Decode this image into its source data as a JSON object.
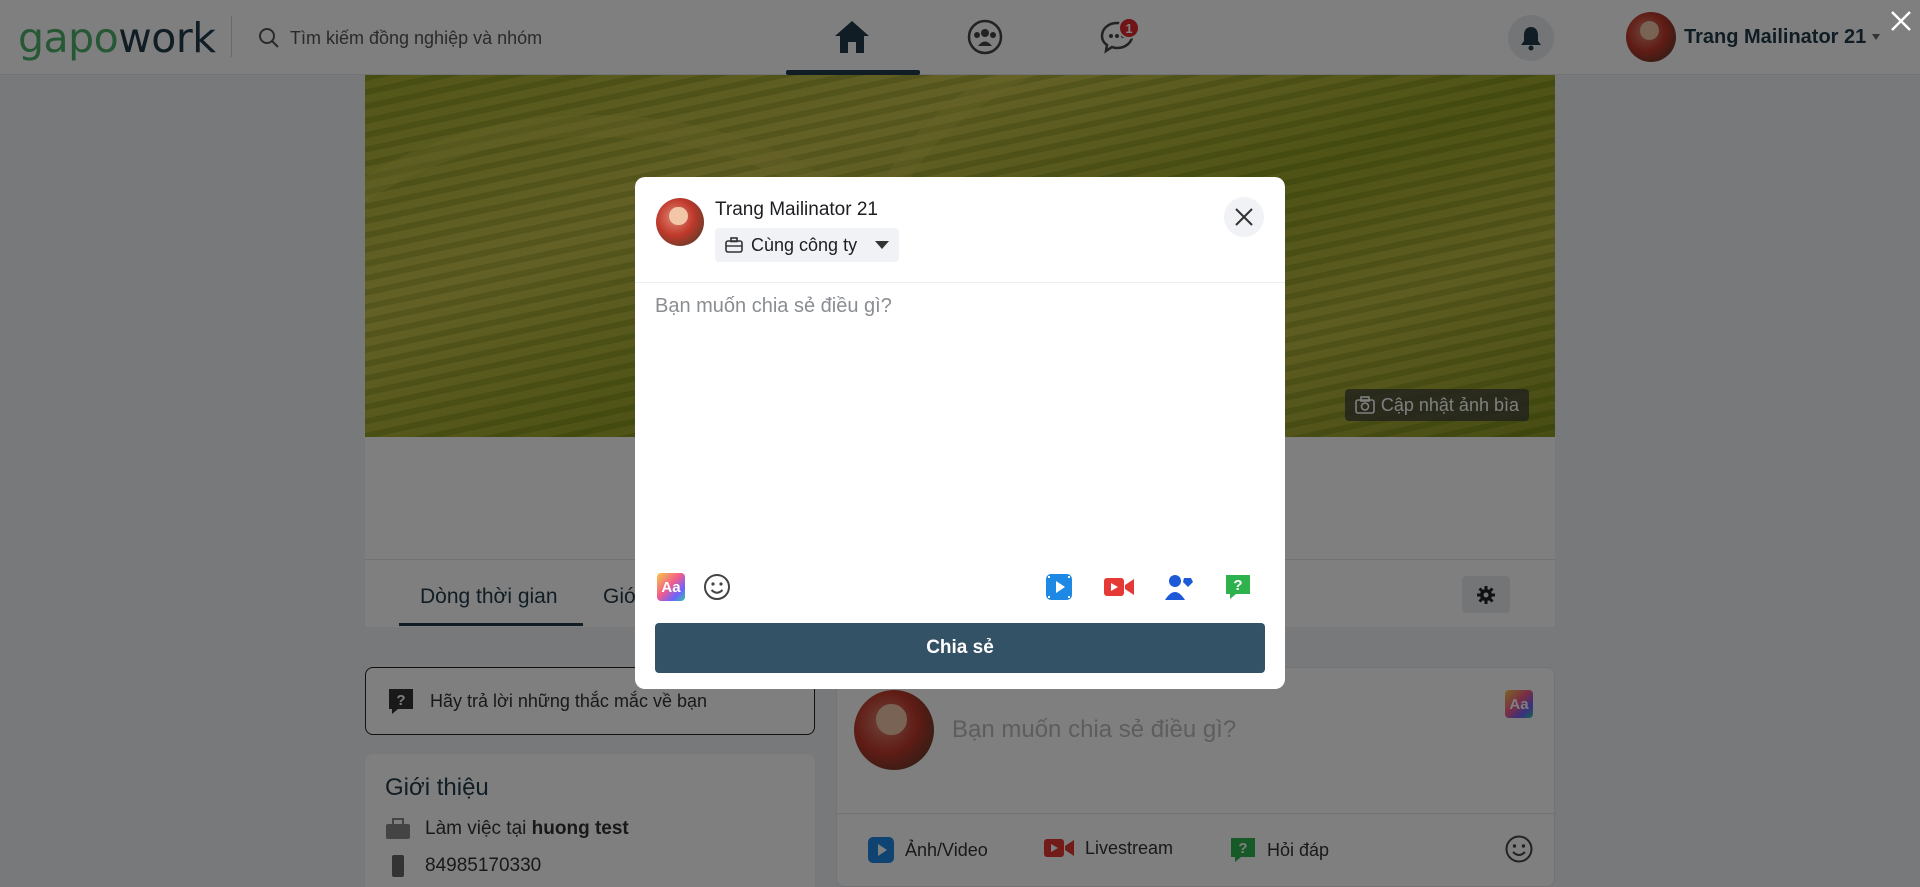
{
  "header": {
    "logo_gapo": "gapo",
    "logo_work": "work",
    "search_placeholder": "Tìm kiếm đồng nghiệp và nhóm",
    "chat_badge": "1",
    "username": "Trang Mailinator 21"
  },
  "profile": {
    "cover_button": "Cập nhật ảnh bìa",
    "tabs": [
      "Dòng thời gian",
      "Giớ"
    ],
    "qa_prompt": "Hãy trả lời những thắc mắc về bạn",
    "intro_title": "Giới thiệu",
    "work_prefix": "Làm việc tại ",
    "work_place": "huong test",
    "phone": "84985170330"
  },
  "composer": {
    "placeholder": "Bạn muốn chia sẻ điều gì?",
    "actions": [
      "Ảnh/Video",
      "Livestream",
      "Hỏi đáp"
    ]
  },
  "modal": {
    "author": "Trang Mailinator 21",
    "privacy": "Cùng công ty",
    "placeholder": "Bạn muốn chia sẻ điều gì?",
    "share_button": "Chia sẻ",
    "text_style_icon": "Aa"
  },
  "colors": {
    "brand_green": "#4fb16d",
    "brand_navy": "#233a4b",
    "share_button": "#335266",
    "badge_red": "#e0282e"
  }
}
